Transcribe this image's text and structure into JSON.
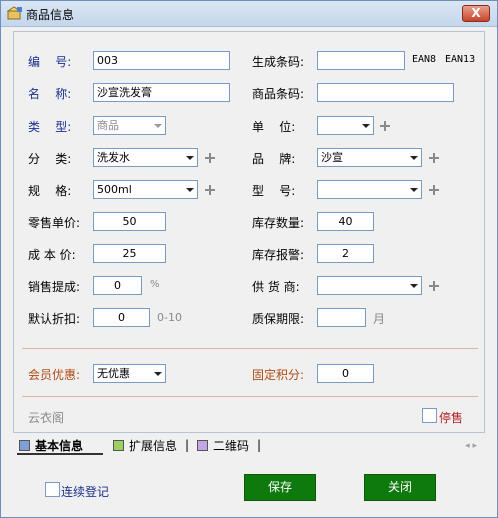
{
  "window": {
    "title": "商品信息",
    "close_label": "X"
  },
  "form": {
    "code_label": "编    号:",
    "code_value": "003",
    "barcode_gen_label": "生成条码:",
    "barcode_gen_value": "",
    "ean8": "EAN8",
    "ean13": "EAN13",
    "name_label": "名    称:",
    "name_value": "沙宣洗发膏",
    "product_barcode_label": "商品条码:",
    "product_barcode_value": "",
    "type_label": "类    型:",
    "type_value": "商品",
    "unit_label": "单    位:",
    "unit_value": "",
    "category_label": "分    类:",
    "category_value": "洗发水",
    "brand_label": "品    牌:",
    "brand_value": "沙宣",
    "spec_label": "规    格:",
    "spec_value": "500ml",
    "model_label": "型    号:",
    "model_value": "",
    "retail_price_label": "零售单价:",
    "retail_price_value": "50",
    "stock_qty_label": "库存数量:",
    "stock_qty_value": "40",
    "cost_price_label": "成 本 价:",
    "cost_price_value": "25",
    "stock_alert_label": "库存报警:",
    "stock_alert_value": "2",
    "commission_label": "销售提成:",
    "commission_value": "0",
    "commission_unit": "%",
    "supplier_label": "供 货 商:",
    "supplier_value": "",
    "discount_label": "默认折扣:",
    "discount_value": "0",
    "discount_range": "0-10",
    "shelf_life_label": "质保期限:",
    "shelf_life_value": "",
    "shelf_life_unit": "月",
    "member_discount_label": "会员优惠:",
    "member_discount_value": "无优惠",
    "fixed_points_label": "固定积分:",
    "fixed_points_value": "0",
    "brand_text": "云衣阁",
    "discontinued_label": "停售"
  },
  "tabs": [
    {
      "label": "基本信息",
      "color": "#7f9fd6"
    },
    {
      "label": "扩展信息",
      "color": "#9ed060"
    },
    {
      "label": "二维码",
      "color": "#c3a6e6"
    }
  ],
  "footer": {
    "continuous_label": "连续登记",
    "save_label": "保存",
    "close_label": "关闭"
  },
  "colors": {
    "accent_green": "#0e7a0e",
    "label_blue": "#1a2f8c",
    "label_orange": "#b04a14"
  }
}
